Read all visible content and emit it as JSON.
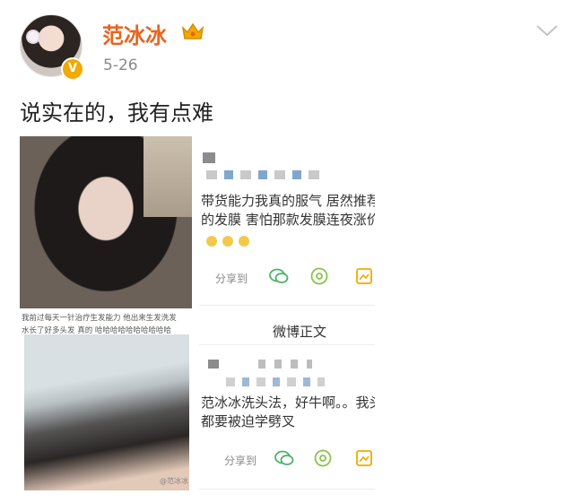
{
  "header": {
    "username": "范冰冰",
    "date": "5-26",
    "verified_badge": "V",
    "more_icon": "chevron-down-icon"
  },
  "post": {
    "text": "说实在的，我有点难"
  },
  "collage": {
    "caption_line1": "我前过每天一针治疗生发能力  他出来生发洗发",
    "caption_line2": "水长了好多头发 真的 哈哈哈哈哈哈哈哈哈哈",
    "watermark": "@范冰冰"
  },
  "card1": {
    "text_line1": "带货能力我真的服气  居然推荐",
    "text_line2": "的发膜  害怕那款发膜连夜涨价",
    "share_label": "分享到"
  },
  "card2": {
    "header_title": "微博正文",
    "text_line1": "范冰冰洗头法，好牛啊。。我头",
    "text_line2": "都要被迫学劈叉",
    "share_label": "分享到"
  },
  "colors": {
    "username": "#e8641e",
    "icon_green": "#4db36b",
    "icon_orange": "#f2a900"
  }
}
